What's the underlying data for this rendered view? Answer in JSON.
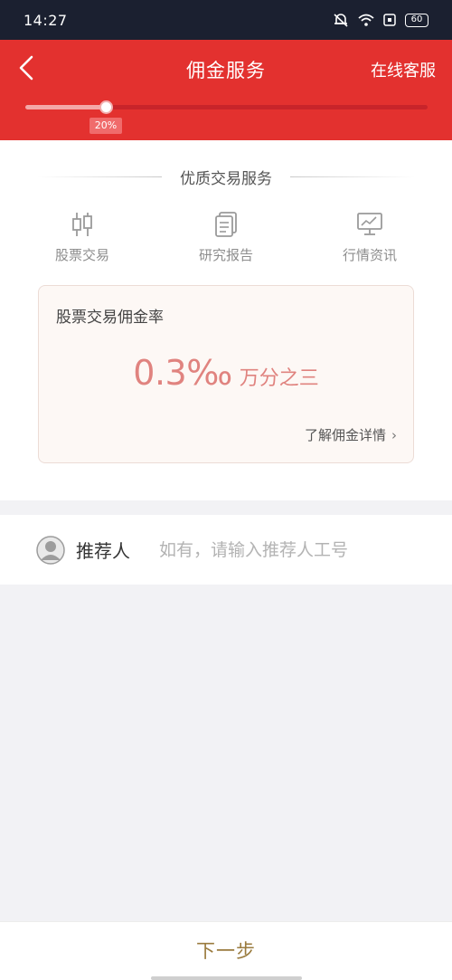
{
  "status_bar": {
    "time": "14:27",
    "battery": "60",
    "icons": [
      "mute-bell-icon",
      "wifi-icon",
      "sim-icon",
      "battery-icon"
    ]
  },
  "header": {
    "title": "佣金服务",
    "right_action": "在线客服",
    "back_icon": "chevron-left-icon",
    "background_color": "#e3312f"
  },
  "progress": {
    "percent": 20,
    "label": "20%"
  },
  "services": {
    "heading": "优质交易服务",
    "items": [
      {
        "label": "股票交易",
        "icon": "candlestick-icon"
      },
      {
        "label": "研究报告",
        "icon": "document-icon"
      },
      {
        "label": "行情资讯",
        "icon": "monitor-chart-icon"
      }
    ]
  },
  "commission": {
    "title": "股票交易佣金率",
    "rate": "0.3‰",
    "rate_text": "万分之三",
    "link": "了解佣金详情",
    "link_icon": "chevron-right-icon",
    "accent_color": "#e0837f"
  },
  "referrer": {
    "label": "推荐人",
    "placeholder": "如有，请输入推荐人工号",
    "value": "",
    "icon": "person-avatar-icon"
  },
  "footer": {
    "next_label": "下一步",
    "accent_color": "#9a7b3e"
  }
}
